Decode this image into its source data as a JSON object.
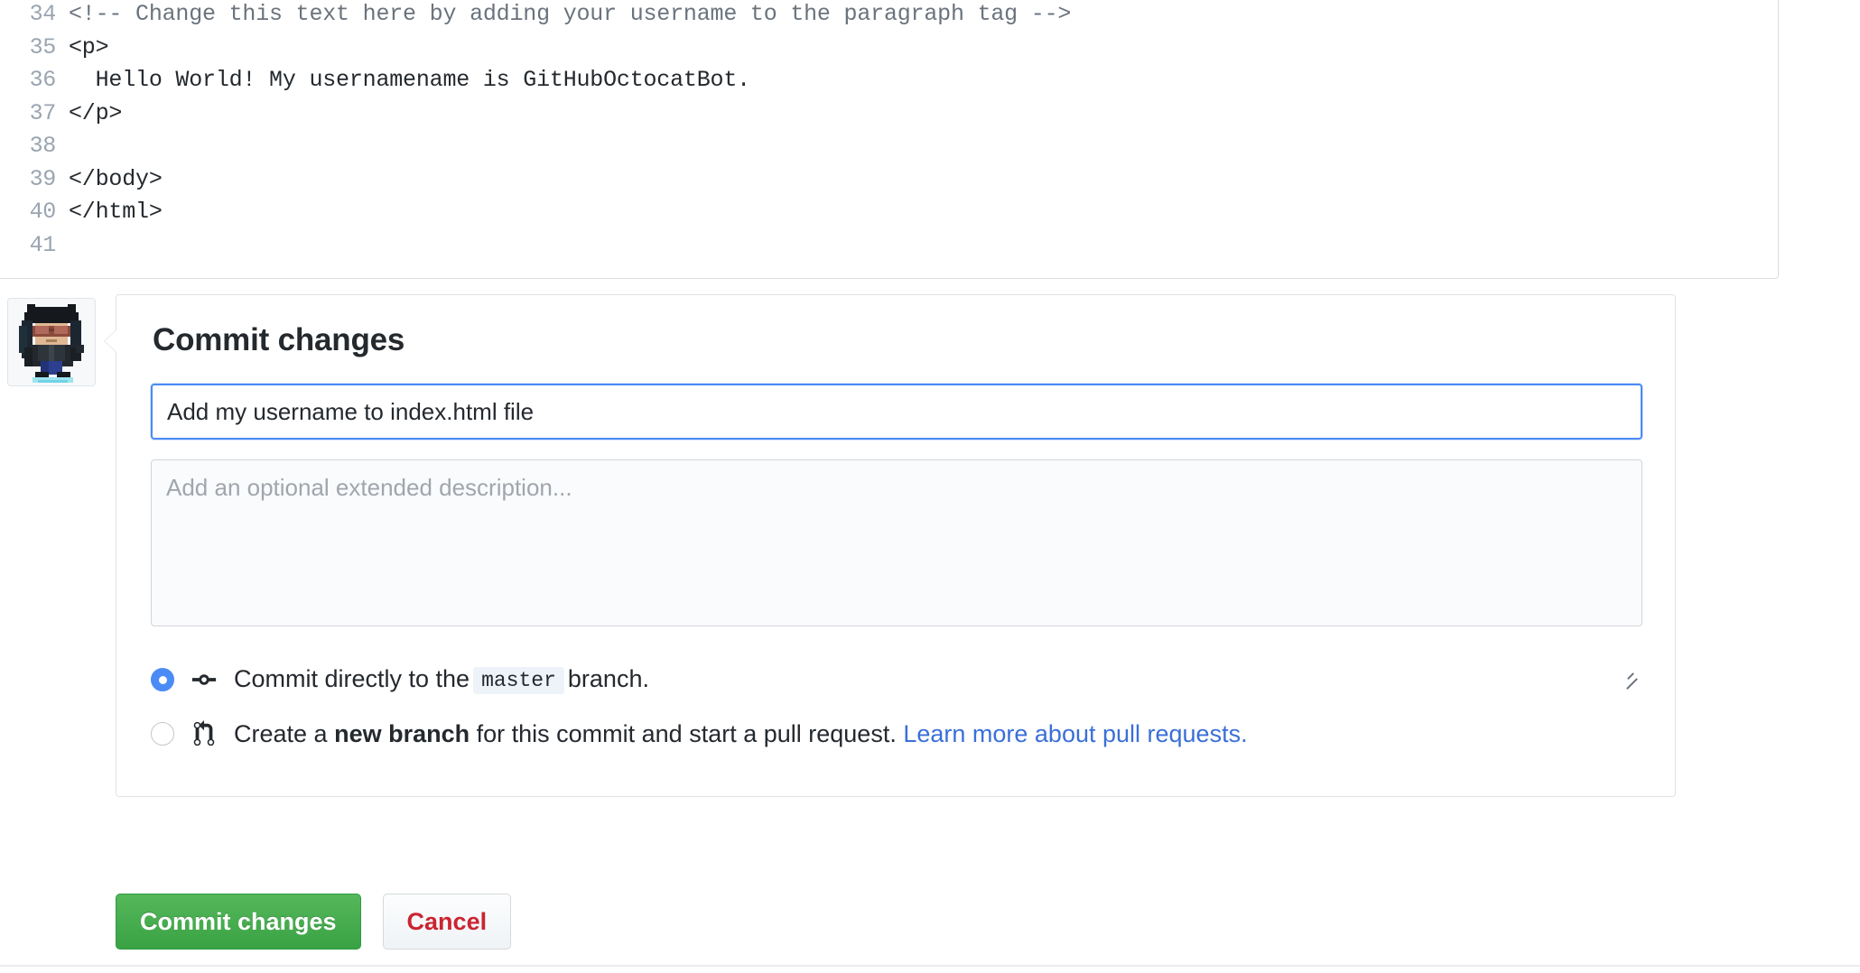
{
  "editor": {
    "lines": [
      {
        "number": "34",
        "text": "<!-- Change this text here by adding your username to the paragraph tag -->",
        "kind": "comment"
      },
      {
        "number": "35",
        "text": "<p>",
        "kind": "code"
      },
      {
        "number": "36",
        "text": "  Hello World! My usernamename is GitHubOctocatBot.",
        "kind": "code"
      },
      {
        "number": "37",
        "text": "</p>",
        "kind": "code"
      },
      {
        "number": "38",
        "text": "",
        "kind": "code"
      },
      {
        "number": "39",
        "text": "</body>",
        "kind": "code"
      },
      {
        "number": "40",
        "text": "</html>",
        "kind": "code"
      },
      {
        "number": "41",
        "text": "",
        "kind": "code"
      }
    ]
  },
  "commit_form": {
    "heading": "Commit changes",
    "summary": {
      "value": "Add my username to index.html file",
      "placeholder": "Add my username to index.html file"
    },
    "description": {
      "value": "",
      "placeholder": "Add an optional extended description..."
    },
    "options": [
      {
        "id": "commit-direct",
        "checked": true,
        "icon": "git-commit-icon",
        "text_before": "Commit directly to the",
        "branch": "master",
        "text_after": "branch."
      },
      {
        "id": "create-branch",
        "checked": false,
        "icon": "git-pull-request-icon",
        "text_before": "Create a",
        "emphasis": "new branch",
        "text_after": "for this commit and start a pull request.",
        "link": "Learn more about pull requests."
      }
    ],
    "buttons": {
      "submit": "Commit changes",
      "cancel": "Cancel"
    }
  },
  "avatar": {
    "name": "user-avatar"
  },
  "colors": {
    "accent_blue": "#4b8bf5",
    "link_blue": "#3a6fd8",
    "success_green": "#3aa244",
    "danger_red": "#cb2431",
    "border_gray": "#dfe2e5",
    "line_number_gray": "#9aa5b1"
  }
}
